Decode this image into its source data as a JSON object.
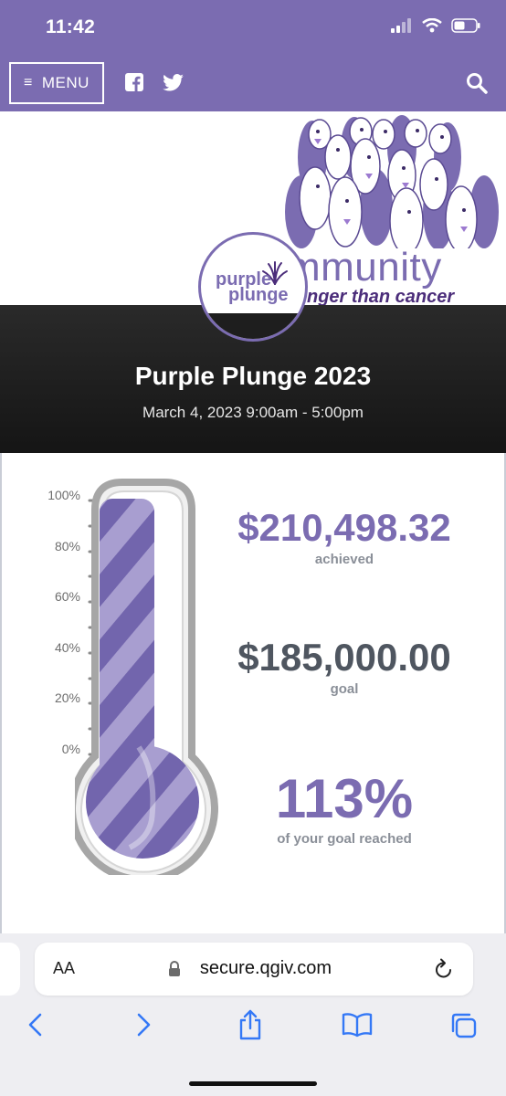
{
  "status_bar": {
    "time": "11:42"
  },
  "header": {
    "menu_label": "MENU"
  },
  "hero": {
    "community_text": "mmunity",
    "community_subtext": "ronger than cancer",
    "logo_word_1": "purple",
    "logo_word_2": "plunge"
  },
  "event": {
    "title": "Purple Plunge 2023",
    "date": "March 4, 2023 9:00am - 5:00pm"
  },
  "thermometer": {
    "tick_labels": [
      "100%",
      "80%",
      "60%",
      "40%",
      "20%",
      "0%"
    ],
    "fill_fraction": 1.0,
    "achieved_value": "$210,498.32",
    "achieved_label": "achieved",
    "goal_value": "$185,000.00",
    "goal_label": "goal",
    "percent_value": "113%",
    "percent_label": "of your goal reached"
  },
  "browser": {
    "aa_label": "AA",
    "url": "secure.qgiv.com"
  },
  "colors": {
    "brand_purple": "#7b6cb1",
    "thermo_fill_light": "#a89ed0",
    "thermo_fill_dark": "#7265ad",
    "goal_gray": "#4f5660"
  },
  "icons": [
    "menu-bars-icon",
    "facebook-icon",
    "twitter-icon",
    "search-icon",
    "lock-icon",
    "reload-icon",
    "back-icon",
    "forward-icon",
    "share-icon",
    "bookmarks-icon",
    "tabs-icon"
  ]
}
